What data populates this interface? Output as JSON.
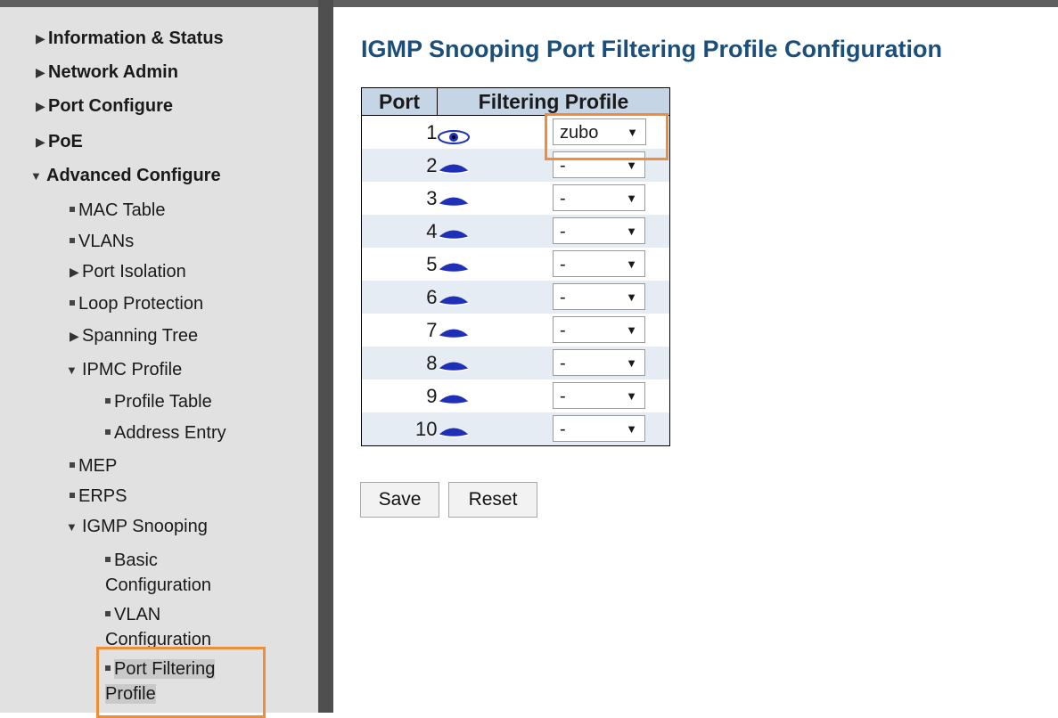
{
  "sidebar": {
    "items": [
      {
        "label": "Information & Status"
      },
      {
        "label": "Network Admin"
      },
      {
        "label": "Port Configure"
      },
      {
        "label": "PoE"
      },
      {
        "label": "Advanced Configure"
      },
      {
        "label": "MAC Table"
      },
      {
        "label": "VLANs"
      },
      {
        "label": "Port Isolation"
      },
      {
        "label": "Loop Protection"
      },
      {
        "label": "Spanning Tree"
      },
      {
        "label": "IPMC Profile"
      },
      {
        "label": "Profile Table"
      },
      {
        "label": "Address Entry"
      },
      {
        "label": "MEP"
      },
      {
        "label": "ERPS"
      },
      {
        "label": "IGMP Snooping"
      },
      {
        "label": "Basic Configuration"
      },
      {
        "label": "VLAN Configuration"
      },
      {
        "label": "Port Filtering Profile"
      }
    ],
    "selected": "Port Filtering Profile"
  },
  "main": {
    "title": "IGMP Snooping Port Filtering Profile Configuration",
    "table": {
      "headers": [
        "Port",
        "Filtering Profile"
      ],
      "rows": [
        {
          "port": "1",
          "profile": "zubo"
        },
        {
          "port": "2",
          "profile": "-"
        },
        {
          "port": "3",
          "profile": "-"
        },
        {
          "port": "4",
          "profile": "-"
        },
        {
          "port": "5",
          "profile": "-"
        },
        {
          "port": "6",
          "profile": "-"
        },
        {
          "port": "7",
          "profile": "-"
        },
        {
          "port": "8",
          "profile": "-"
        },
        {
          "port": "9",
          "profile": "-"
        },
        {
          "port": "10",
          "profile": "-"
        }
      ]
    },
    "buttons": {
      "save": "Save",
      "reset": "Reset"
    }
  },
  "icons": {
    "expand": "triangle-right-icon",
    "collapse": "triangle-down-icon",
    "view": "eye-icon"
  },
  "colors": {
    "title": "#1b4f7a",
    "header_bg": "#c6d5e6",
    "highlight": "#ef8d3a",
    "eye_icon": "#1e2fb8"
  }
}
